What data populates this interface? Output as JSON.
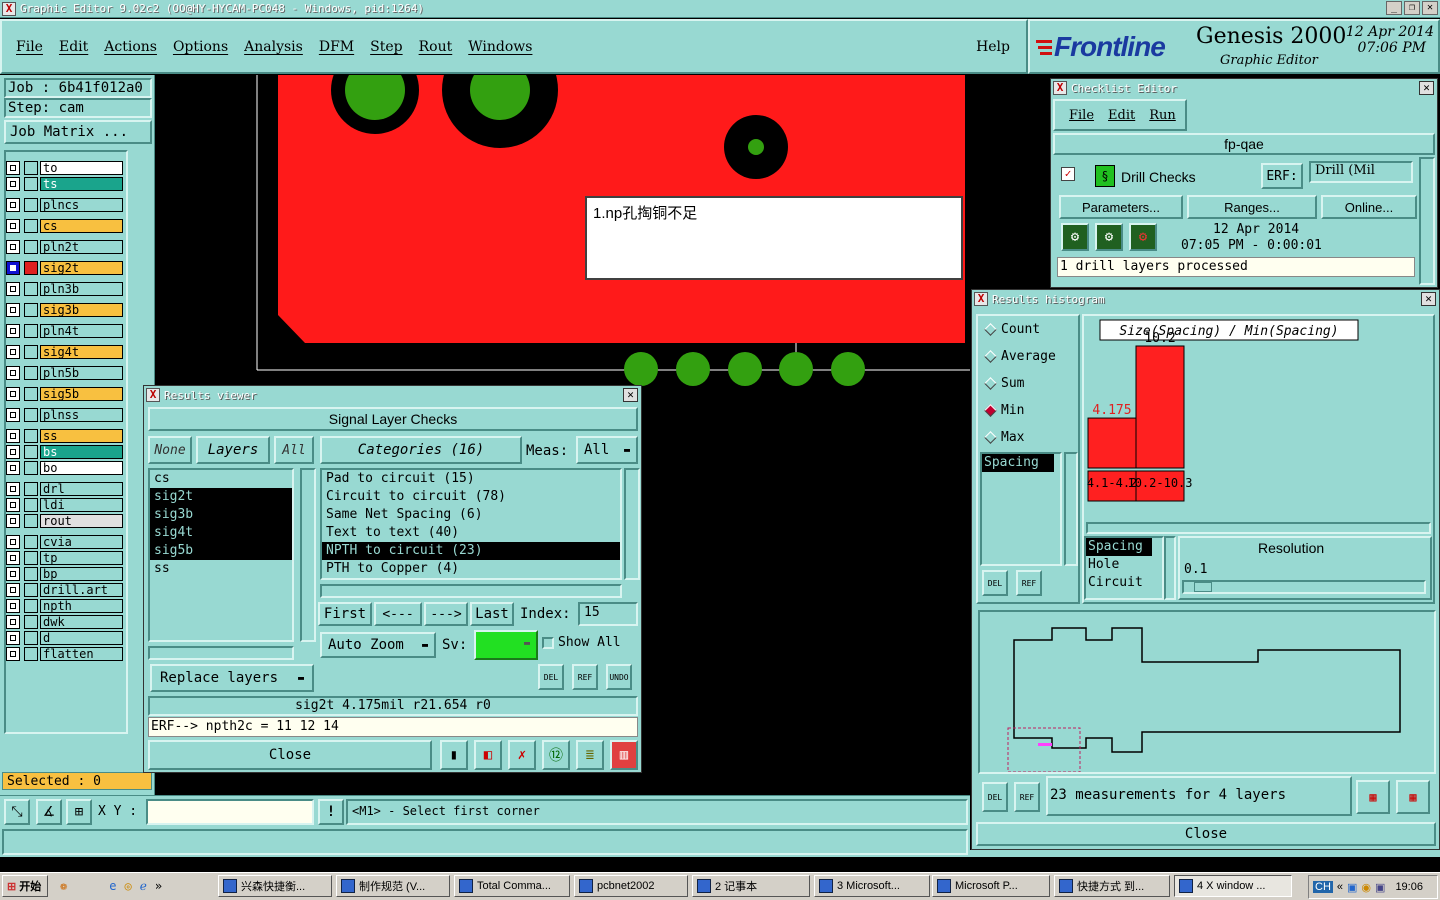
{
  "window": {
    "title": "Graphic Editor 9.02c2  (OO@HY-HYCAM-PC048 - Windows, pid:1264)"
  },
  "menubar": {
    "items": [
      "File",
      "Edit",
      "Actions",
      "Options",
      "Analysis",
      "DFM",
      "Step",
      "Rout",
      "Windows"
    ],
    "help": "Help"
  },
  "brand": {
    "logo": "Frontline",
    "product": "Genesis 2000",
    "subtitle": "Graphic Editor",
    "date": "12 Apr 2014",
    "time": "07:06 PM"
  },
  "job": {
    "job_label": "Job  :  6b41f012a0",
    "step_label": "Step:  cam",
    "matrix_button": "Job Matrix ..."
  },
  "layers": [
    {
      "name": "to",
      "color": "#ffffff",
      "active": false
    },
    {
      "name": "ts",
      "color": "#1aa48c",
      "active": false
    },
    {
      "name": "plncs",
      "color": "#98d9d2",
      "active": false
    },
    {
      "name": "cs",
      "color": "#f8c040",
      "active": false
    },
    {
      "name": "pln2t",
      "color": "#98d9d2",
      "active": false
    },
    {
      "name": "sig2t",
      "color": "#f8c040",
      "active": true
    },
    {
      "name": "pln3b",
      "color": "#98d9d2",
      "active": false
    },
    {
      "name": "sig3b",
      "color": "#f8c040",
      "active": false
    },
    {
      "name": "pln4t",
      "color": "#98d9d2",
      "active": false
    },
    {
      "name": "sig4t",
      "color": "#f8c040",
      "active": false
    },
    {
      "name": "pln5b",
      "color": "#98d9d2",
      "active": false
    },
    {
      "name": "sig5b",
      "color": "#f8c040",
      "active": false
    },
    {
      "name": "plnss",
      "color": "#98d9d2",
      "active": false
    },
    {
      "name": "ss",
      "color": "#f8c040",
      "active": false
    },
    {
      "name": "bs",
      "color": "#1aa48c",
      "active": false
    },
    {
      "name": "bo",
      "color": "#ffffff",
      "active": false
    },
    {
      "name": "drl",
      "color": "#98d9d2",
      "active": false
    },
    {
      "name": "ldi",
      "color": "#98d9d2",
      "active": false
    },
    {
      "name": "rout",
      "color": "#e0e0e0",
      "active": false
    },
    {
      "name": "cvia",
      "color": "#98d9d2",
      "active": false
    },
    {
      "name": "tp",
      "color": "#98d9d2",
      "active": false
    },
    {
      "name": "bp",
      "color": "#98d9d2",
      "active": false
    },
    {
      "name": "drill.art",
      "color": "#98d9d2",
      "active": false
    },
    {
      "name": "npth",
      "color": "#98d9d2",
      "active": false
    },
    {
      "name": "dwk",
      "color": "#98d9d2",
      "active": false
    },
    {
      "name": "d",
      "color": "#98d9d2",
      "active": false
    },
    {
      "name": "flatten",
      "color": "#98d9d2",
      "active": false
    }
  ],
  "selected": {
    "label": "Selected : 0"
  },
  "annotation": {
    "text": "1.np孔掏铜不足"
  },
  "status": {
    "xy_label": "X Y :",
    "message": "<M1> - Select first corner",
    "xy_value": ""
  },
  "results_viewer": {
    "title": "Results viewer",
    "heading": "Signal Layer Checks",
    "none": "None",
    "layers": "Layers",
    "all": "All",
    "categories": "Categories (16)",
    "meas_label": "Meas:",
    "meas_value": "All",
    "layer_list": [
      "cs",
      "sig2t",
      "sig3b",
      "sig4t",
      "sig5b",
      "ss"
    ],
    "category_list": [
      "Pad to circuit (15)",
      "Circuit to circuit (78)",
      "Same Net Spacing (6)",
      "Text to text (40)",
      "NPTH to circuit (23)",
      "PTH to Copper (4)"
    ],
    "first": "First",
    "prev": "<---",
    "next": "--->",
    "last": "Last",
    "index_label": "Index:",
    "index_value": "15",
    "autozoom": "Auto Zoom",
    "sv_label": "Sv:",
    "show_all": "Show All",
    "replace": "Replace layers",
    "info": "sig2t 4.175mil   r21.654   r0",
    "erf": "ERF--> npth2c = 11 12 14",
    "close": "Close"
  },
  "checklist": {
    "title": "Checklist Editor",
    "menu": [
      "File",
      "Edit",
      "Run"
    ],
    "name": "fp-qae",
    "check": "Drill Checks",
    "erf_label": "ERF:",
    "erf_value": "Drill (Mil",
    "buttons": [
      "Parameters...",
      "Ranges...",
      "Online..."
    ],
    "date": "12 Apr 2014",
    "time": "07:05 PM - 0:00:01",
    "log": "1 drill layers processed"
  },
  "histogram": {
    "title": "Results histogram",
    "options": [
      "Count",
      "Average",
      "Sum",
      "Min",
      "Max"
    ],
    "selected_option": "Min",
    "list": [
      "Spacing"
    ],
    "chart_title": "Size(Spacing) / Min(Spacing)",
    "bars": [
      {
        "value": 4.175,
        "label": "4.175",
        "range": "4.1-4.2"
      },
      {
        "value": 10.2,
        "label": "10.2",
        "range": "10.2-10.3"
      }
    ],
    "types": [
      "Spacing",
      "Hole",
      "Circuit"
    ],
    "resolution_label": "Resolution",
    "resolution_value": "0.1",
    "summary": "23 measurements for 4 layers",
    "close": "Close"
  },
  "taskbar": {
    "start": "开始",
    "tasks": [
      "兴森快捷衡...",
      "制作规范 (V...",
      "Total Comma...",
      "pcbnet2002",
      "2 记事本",
      "3 Microsoft...",
      "Microsoft P...",
      "快捷方式 到...",
      "4 X window ..."
    ],
    "clock": "19:06"
  }
}
